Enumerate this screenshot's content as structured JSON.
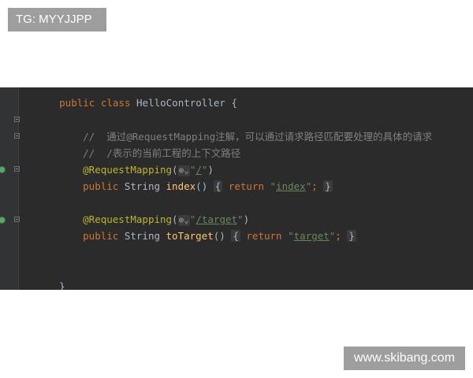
{
  "watermarks": {
    "top_left": "TG: MYYJJPP",
    "bottom_right": "www.skibang.com"
  },
  "editor": {
    "lines": {
      "class_decl": {
        "kw1": "public",
        "kw2": "class",
        "name": "HelloController",
        "brace": "{"
      },
      "comment1": "//  通过@RequestMapping注解，可以通过请求路径匹配要处理的具体的请求",
      "comment2": "//  /表示的当前工程的上下文路径",
      "ann1": {
        "name": "@RequestMapping",
        "open": "(",
        "path": "/",
        "close": ")"
      },
      "method1": {
        "kw": "public",
        "type": "String",
        "name": "index",
        "parens": "()",
        "body_open": "{",
        "ret": "return",
        "value": "index",
        "semi": ";",
        "body_close": "}"
      },
      "ann2": {
        "name": "@RequestMapping",
        "open": "(",
        "path": "/target",
        "close": ")"
      },
      "method2": {
        "kw": "public",
        "type": "String",
        "name": "toTarget",
        "parens": "()",
        "body_open": "{",
        "ret": "return",
        "value": "target",
        "semi": ";",
        "body_close": "}"
      },
      "class_close": "}"
    },
    "colors": {
      "background": "#2b2b2b",
      "keyword": "#cc7832",
      "annotation": "#bbb529",
      "string": "#6a8759",
      "method": "#ffc66d",
      "comment": "#808080",
      "text": "#a9b7c6"
    }
  }
}
